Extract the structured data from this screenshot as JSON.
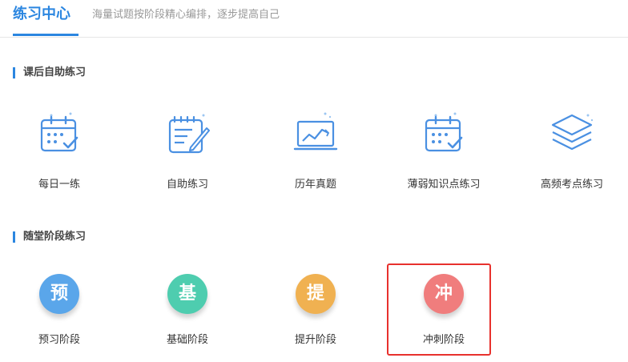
{
  "header": {
    "title": "练习中心",
    "subtitle": "海量试题按阶段精心编排，逐步提高自己"
  },
  "sections": [
    {
      "title": "课后自助练习",
      "items": [
        {
          "label": "每日一练",
          "icon": "calendar-check-icon"
        },
        {
          "label": "自助练习",
          "icon": "notebook-pen-icon"
        },
        {
          "label": "历年真题",
          "icon": "laptop-chart-icon"
        },
        {
          "label": "薄弱知识点练习",
          "icon": "calendar-check-icon"
        },
        {
          "label": "高频考点练习",
          "icon": "layers-icon"
        }
      ]
    },
    {
      "title": "随堂阶段练习",
      "items": [
        {
          "label": "预习阶段",
          "char": "预",
          "color": "#5aa6ea"
        },
        {
          "label": "基础阶段",
          "char": "基",
          "color": "#4ecdaf"
        },
        {
          "label": "提升阶段",
          "char": "提",
          "color": "#f0b151"
        },
        {
          "label": "冲刺阶段",
          "char": "冲",
          "color": "#f07d7d",
          "highlighted": true
        }
      ]
    }
  ],
  "colors": {
    "accent": "#2b86e0",
    "icon_blue": "#4a90e2",
    "highlight_border": "#e8312d"
  }
}
